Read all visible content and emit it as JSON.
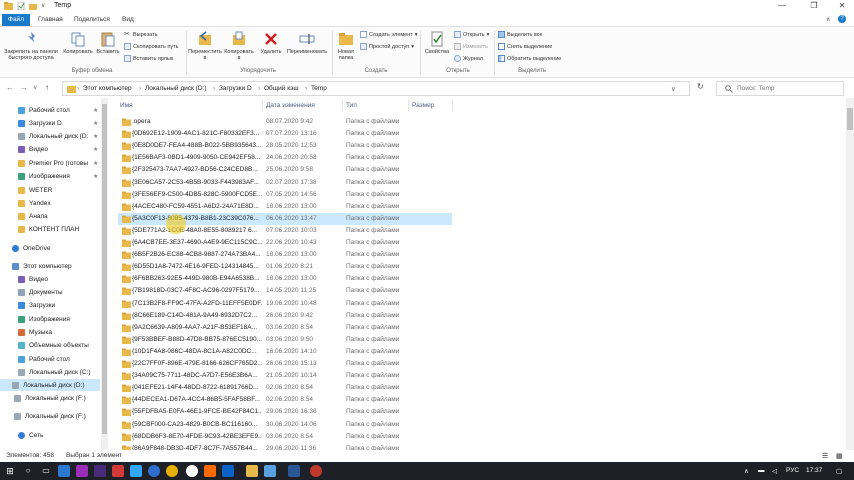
{
  "window": {
    "title": "Temp"
  },
  "ribbon_tabs": [
    "Файл",
    "Главная",
    "Поделиться",
    "Вид"
  ],
  "ribbon": {
    "pin_label": "Закрепить на панели быстрого доступа",
    "copy_label": "Копировать",
    "paste_label": "Вставить",
    "cut_label": "Вырезать",
    "copy_path_label": "Скопировать путь",
    "paste_shortcut_label": "Вставить ярлык",
    "clipboard_group": "Буфер обмена",
    "move_to_label": "Переместить в",
    "copy_to_label": "Копировать в",
    "delete_label": "Удалить",
    "rename_label": "Переименовать",
    "organize_group": "Упорядочить",
    "new_folder_label": "Новая папка",
    "new_item_label": "Создать элемент",
    "easy_access_label": "Простой доступ",
    "create_group": "Создать",
    "properties_label": "Свойства",
    "open_label": "Открыть",
    "edit_label": "Изменить",
    "history_label": "Журнал",
    "open_group": "Открыть",
    "select_all_label": "Выделить все",
    "select_none_label": "Снять выделение",
    "invert_selection_label": "Обратить выделение",
    "select_group": "Выделить"
  },
  "breadcrumb": [
    "Этот компьютер",
    "Локальный диск (D:)",
    "Загрузки D",
    "Общий кэш",
    "Temp"
  ],
  "search_placeholder": "Поиск: Temp",
  "nav": [
    {
      "label": "Рабочий стол",
      "pinned": true
    },
    {
      "label": "Загрузки D",
      "pinned": true
    },
    {
      "label": "Локальный диск (D:",
      "pinned": true
    },
    {
      "label": "Видео",
      "pinned": true
    },
    {
      "label": "Premier Pro (готовы",
      "pinned": true
    },
    {
      "label": "Изображения",
      "pinned": true
    },
    {
      "label": "WETER",
      "pinned": false
    },
    {
      "label": "Yandex",
      "pinned": false
    },
    {
      "label": "Анапа",
      "pinned": false
    },
    {
      "label": "КОНТЕНТ ПЛАН",
      "pinned": false
    },
    {
      "label": "OneDrive",
      "pinned": false
    },
    {
      "label": "Этот компьютер",
      "pinned": false
    },
    {
      "label": "Видео",
      "pinned": false
    },
    {
      "label": "Документы",
      "pinned": false
    },
    {
      "label": "Загрузки",
      "pinned": false
    },
    {
      "label": "Изображения",
      "pinned": false
    },
    {
      "label": "Музыка",
      "pinned": false
    },
    {
      "label": "Объемные объекты",
      "pinned": false
    },
    {
      "label": "Рабочий стол",
      "pinned": false
    },
    {
      "label": "Локальный диск (C:)",
      "pinned": false
    },
    {
      "label": "Локальный диск (D:)",
      "pinned": false
    },
    {
      "label": "Локальный диск (F:)",
      "pinned": false
    },
    {
      "label": "Локальный диск (F:)",
      "pinned": false
    },
    {
      "label": "Сеть",
      "pinned": false
    }
  ],
  "columns": {
    "name": "Имя",
    "date": "Дата изменения",
    "type": "Тип",
    "size": "Размер"
  },
  "files": [
    {
      "name": ".opera",
      "date": "08.07.2020 9:42",
      "type": "Папка с файлами"
    },
    {
      "name": "{0D692E12-1909-4AC1-821C-F80332EF3...",
      "date": "07.07.2020 13:16",
      "type": "Папка с файлами"
    },
    {
      "name": "{0E8D0DE7-FEA4-488B-B022-5BB935643...",
      "date": "28.05.2020 12:53",
      "type": "Папка с файлами"
    },
    {
      "name": "{1E56BAF3-0BD1-4909-9050-CE942EF58...",
      "date": "24.06.2020 20:58",
      "type": "Папка с файлами"
    },
    {
      "name": "{2F325473-7AA7-4927-BD56-C24CED8B...",
      "date": "25.06.2020 9:58",
      "type": "Папка с файлами"
    },
    {
      "name": "{3E06CA57-2C53-4B5B-9033-F443983AF...",
      "date": "02.07.2020 17:38",
      "type": "Папка с файлами"
    },
    {
      "name": "{3FE56EF9-C500-4DB5-828C-5900FCD5E...",
      "date": "07.05.2020 14:56",
      "type": "Папка с файлами"
    },
    {
      "name": "{4ACEC480-FC59-4551-A6D2-24A71E8D...",
      "date": "18.06.2020 13:00",
      "type": "Папка с файлами"
    },
    {
      "name": "{5A3C0F13-8085-4379-B8B1-23C39C076...",
      "date": "06.06.2020 13:47",
      "type": "Папка с файлами"
    },
    {
      "name": "{5DE771A2-1C0E-48A0-8E55-8089217 6...",
      "date": "07.06.2020 10:03",
      "type": "Папка с файлами"
    },
    {
      "name": "{6A4CB7EE-3E37-4690-A4E9-9EC115C9C...",
      "date": "22.06.2020 10:43",
      "type": "Папка с файлами"
    },
    {
      "name": "{6B5F2B26-EC88-4CB8-9887-274A73BA4...",
      "date": "18.06.2020 13:00",
      "type": "Папка с файлами"
    },
    {
      "name": "{6D55D1A8-7472-4E16-9FED-124314845...",
      "date": "01.06.2020 8:21",
      "type": "Папка с файлами"
    },
    {
      "name": "{6F6BB263-92E5-449D-980B-E94A6538B...",
      "date": "18.06.2020 13:00",
      "type": "Папка с файлами"
    },
    {
      "name": "{7B19818D-03C7-4F8C-AC96-0297F5179...",
      "date": "14.05.2020 11:25",
      "type": "Папка с файлами"
    },
    {
      "name": "{7C13B2F8-FF9C-47FA-A2FD-11EFF5E0DF...",
      "date": "19.06.2020 10:48",
      "type": "Папка с файлами"
    },
    {
      "name": "{8C66E189-C14D-481A-9A49-6932D7C2...",
      "date": "26.06.2020 9:42",
      "type": "Папка с файлами"
    },
    {
      "name": "{9A2C6639-A809-4AA7-A21F-B53EF18A...",
      "date": "03.06.2020 8:54",
      "type": "Папка с файлами"
    },
    {
      "name": "{9F53BBEF-B88D-47D8-BB75-876EC5190...",
      "date": "03.06.2020 9:50",
      "type": "Папка с файлами"
    },
    {
      "name": "{10D1F4A8-086C-48DA-8C1A-A82C0DC...",
      "date": "16.06.2020 14:10",
      "type": "Папка с файлами"
    },
    {
      "name": "{22C7FF0F-896E-479E-8166-626CF765D2...",
      "date": "26.06.2020 15:13",
      "type": "Папка с файлами"
    },
    {
      "name": "{34A09C75-7711-48DC-A7D7-E56E3B6A...",
      "date": "21.05.2020 10:14",
      "type": "Папка с файлами"
    },
    {
      "name": "{041EFE21-14F4-48DD-8722-61891766D...",
      "date": "02.06.2020 8:54",
      "type": "Папка с файлами"
    },
    {
      "name": "{44DECEA1-D67A-4CC4-86B5-5FAF58BF...",
      "date": "02.06.2020 8:54",
      "type": "Папка с файлами"
    },
    {
      "name": "{55FDFBA5-E0FA-46E1-9FCE-BE42F84C1...",
      "date": "29.06.2020 16:36",
      "type": "Папка с файлами"
    },
    {
      "name": "{59CBF000-CA23-4829-B0CB-BC116160...",
      "date": "30.06.2020 14:06",
      "type": "Папка с файлами"
    },
    {
      "name": "{68DDB6F3-8E70-4FDE-9C93-42BE3EFE9...",
      "date": "03.06.2020 8:54",
      "type": "Папка с файлами"
    },
    {
      "name": "{86A9F848-DB3D-4DF7-8C7F-7A557B44...",
      "date": "29.06.2020 11:36",
      "type": "Папка с файлами"
    }
  ],
  "selected_row": 8,
  "status": {
    "count": "Элементов: 458",
    "selected": "Выбран 1 элемент"
  },
  "taskbar": {
    "lang": "РУС",
    "time": "17:37"
  },
  "colors": {
    "accent": "#1979ca",
    "selection": "#cce8ff",
    "folder": "#e8b84a",
    "taskbar": "#1d2026"
  }
}
